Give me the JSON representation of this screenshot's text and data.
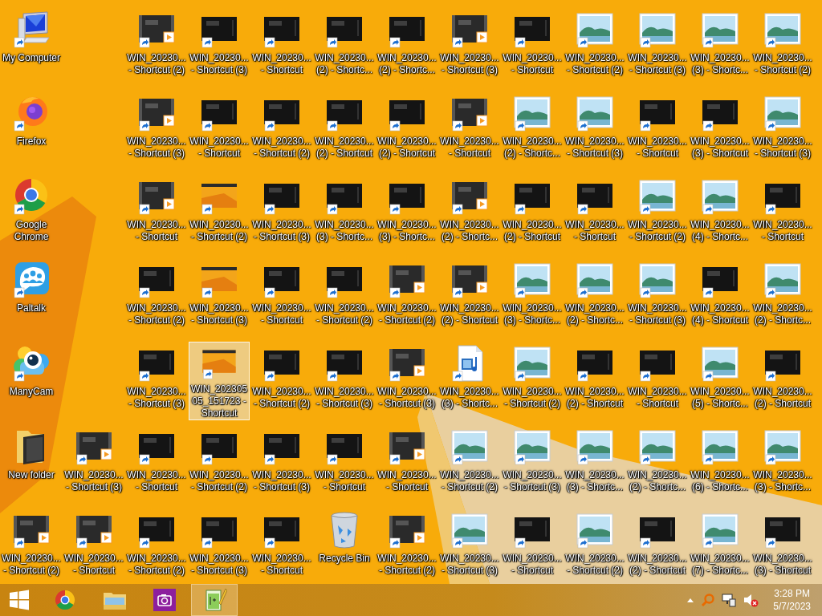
{
  "desktop": {
    "rows": [
      [
        {
          "kind": "computer",
          "label": "My Computer",
          "shortcut": true,
          "selected": false
        },
        {
          "kind": "video",
          "label": "WIN_20230...\n- Shortcut (2)",
          "shortcut": true,
          "selected": false
        },
        {
          "kind": "dark",
          "label": "WIN_20230...\n- Shortcut (3)",
          "shortcut": true,
          "selected": false
        },
        {
          "kind": "dark",
          "label": "WIN_20230...\n- Shortcut",
          "shortcut": true,
          "selected": false
        },
        {
          "kind": "dark",
          "label": "WIN_20230...\n(2) - Shortc...",
          "shortcut": true,
          "selected": false
        },
        {
          "kind": "dark",
          "label": "WIN_20230...\n(2) - Shortc...",
          "shortcut": true,
          "selected": false
        },
        {
          "kind": "video",
          "label": "WIN_20230...\n- Shortcut (3)",
          "shortcut": true,
          "selected": false
        },
        {
          "kind": "dark",
          "label": "WIN_20230...\n- Shortcut",
          "shortcut": true,
          "selected": false
        },
        {
          "kind": "landscape",
          "label": "WIN_20230...\n- Shortcut (2)",
          "shortcut": true,
          "selected": false
        },
        {
          "kind": "landscape",
          "label": "WIN_20230...\n- Shortcut (3)",
          "shortcut": true,
          "selected": false
        },
        {
          "kind": "landscape",
          "label": "WIN_20230...\n(3) - Shortc...",
          "shortcut": true,
          "selected": false
        },
        {
          "kind": "landscape",
          "label": "WIN_20230...\n- Shortcut (2)",
          "shortcut": true,
          "selected": false
        }
      ],
      [
        {
          "kind": "firefox",
          "label": "Firefox",
          "shortcut": true,
          "selected": false
        },
        {
          "kind": "video",
          "label": "WIN_20230...\n- Shortcut (3)",
          "shortcut": true,
          "selected": false
        },
        {
          "kind": "dark",
          "label": "WIN_20230...\n- Shortcut",
          "shortcut": true,
          "selected": false
        },
        {
          "kind": "dark",
          "label": "WIN_20230...\n- Shortcut (2)",
          "shortcut": true,
          "selected": false
        },
        {
          "kind": "dark",
          "label": "WIN_20230...\n(2) - Shortcut",
          "shortcut": true,
          "selected": false
        },
        {
          "kind": "dark",
          "label": "WIN_20230...\n(2) - Shortcut",
          "shortcut": true,
          "selected": false
        },
        {
          "kind": "video",
          "label": "WIN_20230...\n- Shortcut",
          "shortcut": true,
          "selected": false
        },
        {
          "kind": "landscape",
          "label": "WIN_20230...\n(2) - Shortc...",
          "shortcut": true,
          "selected": false
        },
        {
          "kind": "landscape",
          "label": "WIN_20230...\n- Shortcut (3)",
          "shortcut": true,
          "selected": false
        },
        {
          "kind": "dark",
          "label": "WIN_20230...\n- Shortcut",
          "shortcut": true,
          "selected": false
        },
        {
          "kind": "dark",
          "label": "WIN_20230...\n(3) - Shortcut",
          "shortcut": true,
          "selected": false
        },
        {
          "kind": "landscape",
          "label": "WIN_20230...\n- Shortcut (3)",
          "shortcut": true,
          "selected": false
        }
      ],
      [
        {
          "kind": "chrome",
          "label": "Google Chrome",
          "shortcut": true,
          "selected": false
        },
        {
          "kind": "video",
          "label": "WIN_20230...\n- Shortcut",
          "shortcut": true,
          "selected": false
        },
        {
          "kind": "orange",
          "label": "WIN_20230...\n- Shortcut (2)",
          "shortcut": true,
          "selected": false
        },
        {
          "kind": "dark",
          "label": "WIN_20230...\n- Shortcut (3)",
          "shortcut": true,
          "selected": false
        },
        {
          "kind": "dark",
          "label": "WIN_20230...\n(3) - Shortc...",
          "shortcut": true,
          "selected": false
        },
        {
          "kind": "dark",
          "label": "WIN_20230...\n(3) - Shortc...",
          "shortcut": true,
          "selected": false
        },
        {
          "kind": "video",
          "label": "WIN_20230...\n(2) - Shortc...",
          "shortcut": true,
          "selected": false
        },
        {
          "kind": "dark",
          "label": "WIN_20230...\n(2) - Shortcut",
          "shortcut": true,
          "selected": false
        },
        {
          "kind": "dark",
          "label": "WIN_20230...\n- Shortcut",
          "shortcut": true,
          "selected": false
        },
        {
          "kind": "landscape",
          "label": "WIN_20230...\n- Shortcut (2)",
          "shortcut": true,
          "selected": false
        },
        {
          "kind": "landscape",
          "label": "WIN_20230...\n(4) - Shortc...",
          "shortcut": true,
          "selected": false
        },
        {
          "kind": "dark",
          "label": "WIN_20230...\n- Shortcut",
          "shortcut": true,
          "selected": false
        }
      ],
      [
        {
          "kind": "paltalk",
          "label": "Paltalk",
          "shortcut": true,
          "selected": false
        },
        {
          "kind": "dark",
          "label": "WIN_20230...\n- Shortcut (2)",
          "shortcut": true,
          "selected": false
        },
        {
          "kind": "orange",
          "label": "WIN_20230...\n- Shortcut (3)",
          "shortcut": true,
          "selected": false
        },
        {
          "kind": "dark",
          "label": "WIN_20230...\n- Shortcut",
          "shortcut": true,
          "selected": false
        },
        {
          "kind": "dark",
          "label": "WIN_20230...\n- Shortcut (2)",
          "shortcut": true,
          "selected": false
        },
        {
          "kind": "video",
          "label": "WIN_20230...\n- Shortcut (2)",
          "shortcut": true,
          "selected": false
        },
        {
          "kind": "video",
          "label": "WIN_20230...\n(2) - Shortcut",
          "shortcut": true,
          "selected": false
        },
        {
          "kind": "landscape",
          "label": "WIN_20230...\n(3) - Shortc...",
          "shortcut": true,
          "selected": false
        },
        {
          "kind": "landscape",
          "label": "WIN_20230...\n(2) - Shortc...",
          "shortcut": true,
          "selected": false
        },
        {
          "kind": "landscape",
          "label": "WIN_20230...\n- Shortcut (3)",
          "shortcut": true,
          "selected": false
        },
        {
          "kind": "dark",
          "label": "WIN_20230...\n(4) - Shortcut",
          "shortcut": true,
          "selected": false
        },
        {
          "kind": "landscape",
          "label": "WIN_20230...\n(2) - Shortc...",
          "shortcut": true,
          "selected": false
        }
      ],
      [
        {
          "kind": "manycam",
          "label": "ManyCam",
          "shortcut": true,
          "selected": false
        },
        {
          "kind": "dark",
          "label": "WIN_20230...\n- Shortcut (3)",
          "shortcut": true,
          "selected": false
        },
        {
          "kind": "orange",
          "label": "WIN_20230505_151723 - Shortcut",
          "shortcut": true,
          "selected": true
        },
        {
          "kind": "dark",
          "label": "WIN_20230...\n- Shortcut (2)",
          "shortcut": true,
          "selected": false
        },
        {
          "kind": "dark",
          "label": "WIN_20230...\n- Shortcut (3)",
          "shortcut": true,
          "selected": false
        },
        {
          "kind": "video",
          "label": "WIN_20230...\n- Shortcut (3)",
          "shortcut": true,
          "selected": false
        },
        {
          "kind": "mediafile",
          "label": "WIN_20230...\n(3) - Shortc...",
          "shortcut": true,
          "selected": false
        },
        {
          "kind": "landscape",
          "label": "WIN_20230...\n- Shortcut (2)",
          "shortcut": true,
          "selected": false
        },
        {
          "kind": "dark",
          "label": "WIN_20230...\n(2) - Shortcut",
          "shortcut": true,
          "selected": false
        },
        {
          "kind": "dark",
          "label": "WIN_20230...\n- Shortcut",
          "shortcut": true,
          "selected": false
        },
        {
          "kind": "landscape",
          "label": "WIN_20230...\n(5) - Shortc...",
          "shortcut": true,
          "selected": false
        },
        {
          "kind": "dark",
          "label": "WIN_20230...\n(2) - Shortcut",
          "shortcut": true,
          "selected": false
        }
      ],
      [
        {
          "kind": "folder",
          "label": "New folder",
          "shortcut": false,
          "selected": false
        },
        {
          "kind": "video",
          "label": "WIN_20230...\n- Shortcut (3)",
          "shortcut": true,
          "selected": false
        },
        {
          "kind": "dark",
          "label": "WIN_20230...\n- Shortcut",
          "shortcut": true,
          "selected": false
        },
        {
          "kind": "dark",
          "label": "WIN_20230...\n- Shortcut (2)",
          "shortcut": true,
          "selected": false
        },
        {
          "kind": "dark",
          "label": "WIN_20230...\n- Shortcut (3)",
          "shortcut": true,
          "selected": false
        },
        {
          "kind": "dark",
          "label": "WIN_20230...\n- Shortcut",
          "shortcut": true,
          "selected": false
        },
        {
          "kind": "video",
          "label": "WIN_20230...\n- Shortcut",
          "shortcut": true,
          "selected": false
        },
        {
          "kind": "landscape",
          "label": "WIN_20230...\n- Shortcut (2)",
          "shortcut": true,
          "selected": false
        },
        {
          "kind": "landscape",
          "label": "WIN_20230...\n- Shortcut (3)",
          "shortcut": true,
          "selected": false
        },
        {
          "kind": "landscape",
          "label": "WIN_20230...\n(3) - Shortc...",
          "shortcut": true,
          "selected": false
        },
        {
          "kind": "landscape",
          "label": "WIN_20230...\n(2) - Shortc...",
          "shortcut": true,
          "selected": false
        },
        {
          "kind": "landscape",
          "label": "WIN_20230...\n(6) - Shortc...",
          "shortcut": true,
          "selected": false
        },
        {
          "kind": "landscape",
          "label": "WIN_20230...\n(3) - Shortc...",
          "shortcut": true,
          "selected": false
        }
      ],
      [
        {
          "kind": "video",
          "label": "WIN_20230...\n- Shortcut (2)",
          "shortcut": true,
          "selected": false
        },
        {
          "kind": "video",
          "label": "WIN_20230...\n- Shortcut",
          "shortcut": true,
          "selected": false
        },
        {
          "kind": "dark",
          "label": "WIN_20230...\n- Shortcut (2)",
          "shortcut": true,
          "selected": false
        },
        {
          "kind": "dark",
          "label": "WIN_20230...\n- Shortcut (3)",
          "shortcut": true,
          "selected": false
        },
        {
          "kind": "dark",
          "label": "WIN_20230...\n- Shortcut",
          "shortcut": true,
          "selected": false
        },
        {
          "kind": "recycle",
          "label": "Recycle Bin",
          "shortcut": false,
          "selected": false
        },
        {
          "kind": "video",
          "label": "WIN_20230...\n- Shortcut (2)",
          "shortcut": true,
          "selected": false
        },
        {
          "kind": "landscape",
          "label": "WIN_20230...\n- Shortcut (3)",
          "shortcut": true,
          "selected": false
        },
        {
          "kind": "dark",
          "label": "WIN_20230...\n- Shortcut",
          "shortcut": true,
          "selected": false
        },
        {
          "kind": "landscape",
          "label": "WIN_20230...\n- Shortcut (2)",
          "shortcut": true,
          "selected": false
        },
        {
          "kind": "dark",
          "label": "WIN_20230...\n(2) - Shortcut",
          "shortcut": true,
          "selected": false
        },
        {
          "kind": "landscape",
          "label": "WIN_20230...\n(7) - Shortc...",
          "shortcut": true,
          "selected": false
        },
        {
          "kind": "dark",
          "label": "WIN_20230...\n(3) - Shortcut",
          "shortcut": true,
          "selected": false
        }
      ]
    ]
  },
  "taskbar": {
    "apps": [
      {
        "kind": "browser",
        "selected": false
      },
      {
        "kind": "files",
        "selected": false
      },
      {
        "kind": "camera",
        "selected": false
      },
      {
        "kind": "editor",
        "selected": true
      }
    ],
    "tray": {
      "sound_muted": true,
      "time": "3:28 PM",
      "date": "5/7/2023"
    }
  }
}
